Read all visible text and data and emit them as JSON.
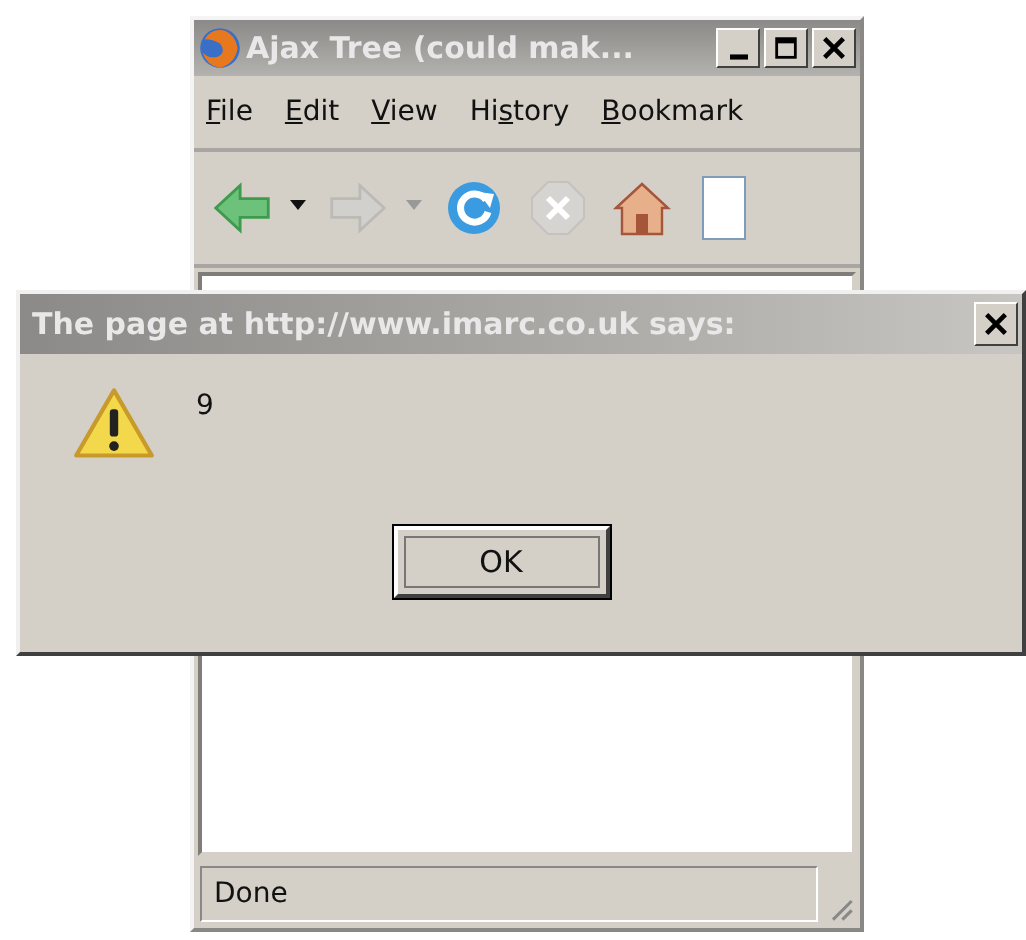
{
  "browser": {
    "title": "Ajax Tree (could mak...",
    "menu": [
      {
        "access_key": "F",
        "after": "ile"
      },
      {
        "access_key": "E",
        "after": "dit"
      },
      {
        "access_key": "V",
        "after": "iew"
      },
      {
        "before": "Hi",
        "access_key": "s",
        "after": "tory"
      },
      {
        "access_key": "B",
        "after": "ookmark"
      }
    ],
    "toolbar": [
      {
        "kind": "back",
        "disabled": false
      },
      {
        "kind": "dropdown",
        "disabled": false
      },
      {
        "kind": "forward",
        "disabled": true
      },
      {
        "kind": "dropdown",
        "disabled": true
      },
      {
        "kind": "reload",
        "disabled": false
      },
      {
        "kind": "stop",
        "disabled": true
      },
      {
        "kind": "home",
        "disabled": false
      }
    ],
    "status_bar": {
      "text": "Done"
    }
  },
  "dialog": {
    "title": "The page at http://www.imarc.co.uk says:",
    "message": "9",
    "buttons": [
      "OK"
    ]
  }
}
